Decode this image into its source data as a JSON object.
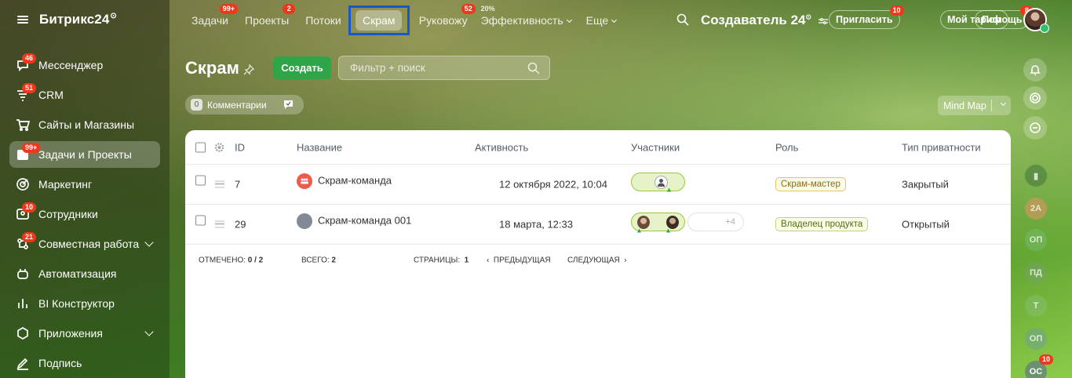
{
  "app": {
    "name": "Битрикс24"
  },
  "sidebar": {
    "items": [
      {
        "label": "Мессенджер",
        "counter": "46",
        "icon": "messenger-icon"
      },
      {
        "label": "CRM",
        "counter": "51",
        "icon": "crm-icon"
      },
      {
        "label": "Сайты и Магазины",
        "counter": "",
        "icon": "cart-icon"
      },
      {
        "label": "Задачи и Проекты",
        "counter": "99+",
        "icon": "tasks-icon",
        "active": true
      },
      {
        "label": "Маркетинг",
        "counter": "",
        "icon": "marketing-icon"
      },
      {
        "label": "Сотрудники",
        "counter": "10",
        "icon": "employees-icon"
      },
      {
        "label": "Совместная работа",
        "counter": "21",
        "icon": "collab-icon",
        "expandable": true
      },
      {
        "label": "Автоматизация",
        "counter": "",
        "icon": "robot-icon"
      },
      {
        "label": "BI Конструктор",
        "counter": "",
        "icon": "bi-chart-icon"
      },
      {
        "label": "Приложения",
        "counter": "",
        "icon": "apps-icon",
        "expandable": true
      },
      {
        "label": "Подпись",
        "counter": "",
        "icon": "signature-icon"
      }
    ]
  },
  "topbar": {
    "nav": {
      "tasks": {
        "label": "Задачи",
        "counter": "99+"
      },
      "projects": {
        "label": "Проекты",
        "counter": "2"
      },
      "flows": {
        "label": "Потоки"
      },
      "scrum": {
        "label": "Скрам"
      },
      "supervise": {
        "label": "Руковожу",
        "counter": "52"
      },
      "efficiency": {
        "label": "Эффективность",
        "percent": "20%"
      },
      "more": {
        "label": "Еще"
      }
    },
    "creator": "Создаватель 24",
    "invite": {
      "label": "Пригласить",
      "counter": "10"
    },
    "tariff": {
      "label": "Мой тариф"
    },
    "help": {
      "label": "Помощь",
      "counter": "8"
    }
  },
  "page": {
    "title": "Скрам",
    "create_label": "Создать",
    "filter_placeholder": "Фильтр + поиск",
    "comments": {
      "count": "0",
      "label": "Комментарии"
    },
    "view_mode": "Mind Map"
  },
  "grid": {
    "columns": {
      "id": "ID",
      "name": "Название",
      "activity": "Активность",
      "members": "Участники",
      "role": "Роль",
      "privacy": "Тип приватности"
    },
    "rows": [
      {
        "id": "7",
        "name": "Скрам-команда",
        "activity": "12 октября 2022, 10:04",
        "role": "Скрам-мастер",
        "privacy": "Закрытый",
        "extra_members": ""
      },
      {
        "id": "29",
        "name": "Скрам-команда 001",
        "activity": "18 марта, 12:33",
        "role": "Владелец продукта",
        "privacy": "Открытый",
        "extra_members": "+4"
      }
    ],
    "footer": {
      "selected_label": "Отмечено:",
      "selected_value": "0 / 2",
      "total_label": "Всего:",
      "total_value": "2",
      "pages_label": "Страницы:",
      "pages_value": "1",
      "prev_label": "Предыдущая",
      "next_label": "Следующая"
    }
  },
  "rail": {
    "avatars": [
      {
        "initials": "2А"
      },
      {
        "initials": "ОП"
      },
      {
        "initials": "ПД"
      },
      {
        "initials": "Т"
      },
      {
        "initials": "ОП"
      },
      {
        "initials": "ОС",
        "counter": "10"
      }
    ]
  },
  "colors": {
    "accent_green": "#2fa54a",
    "counter_red": "#f0371c",
    "highlight_blue": "#1957c9"
  }
}
